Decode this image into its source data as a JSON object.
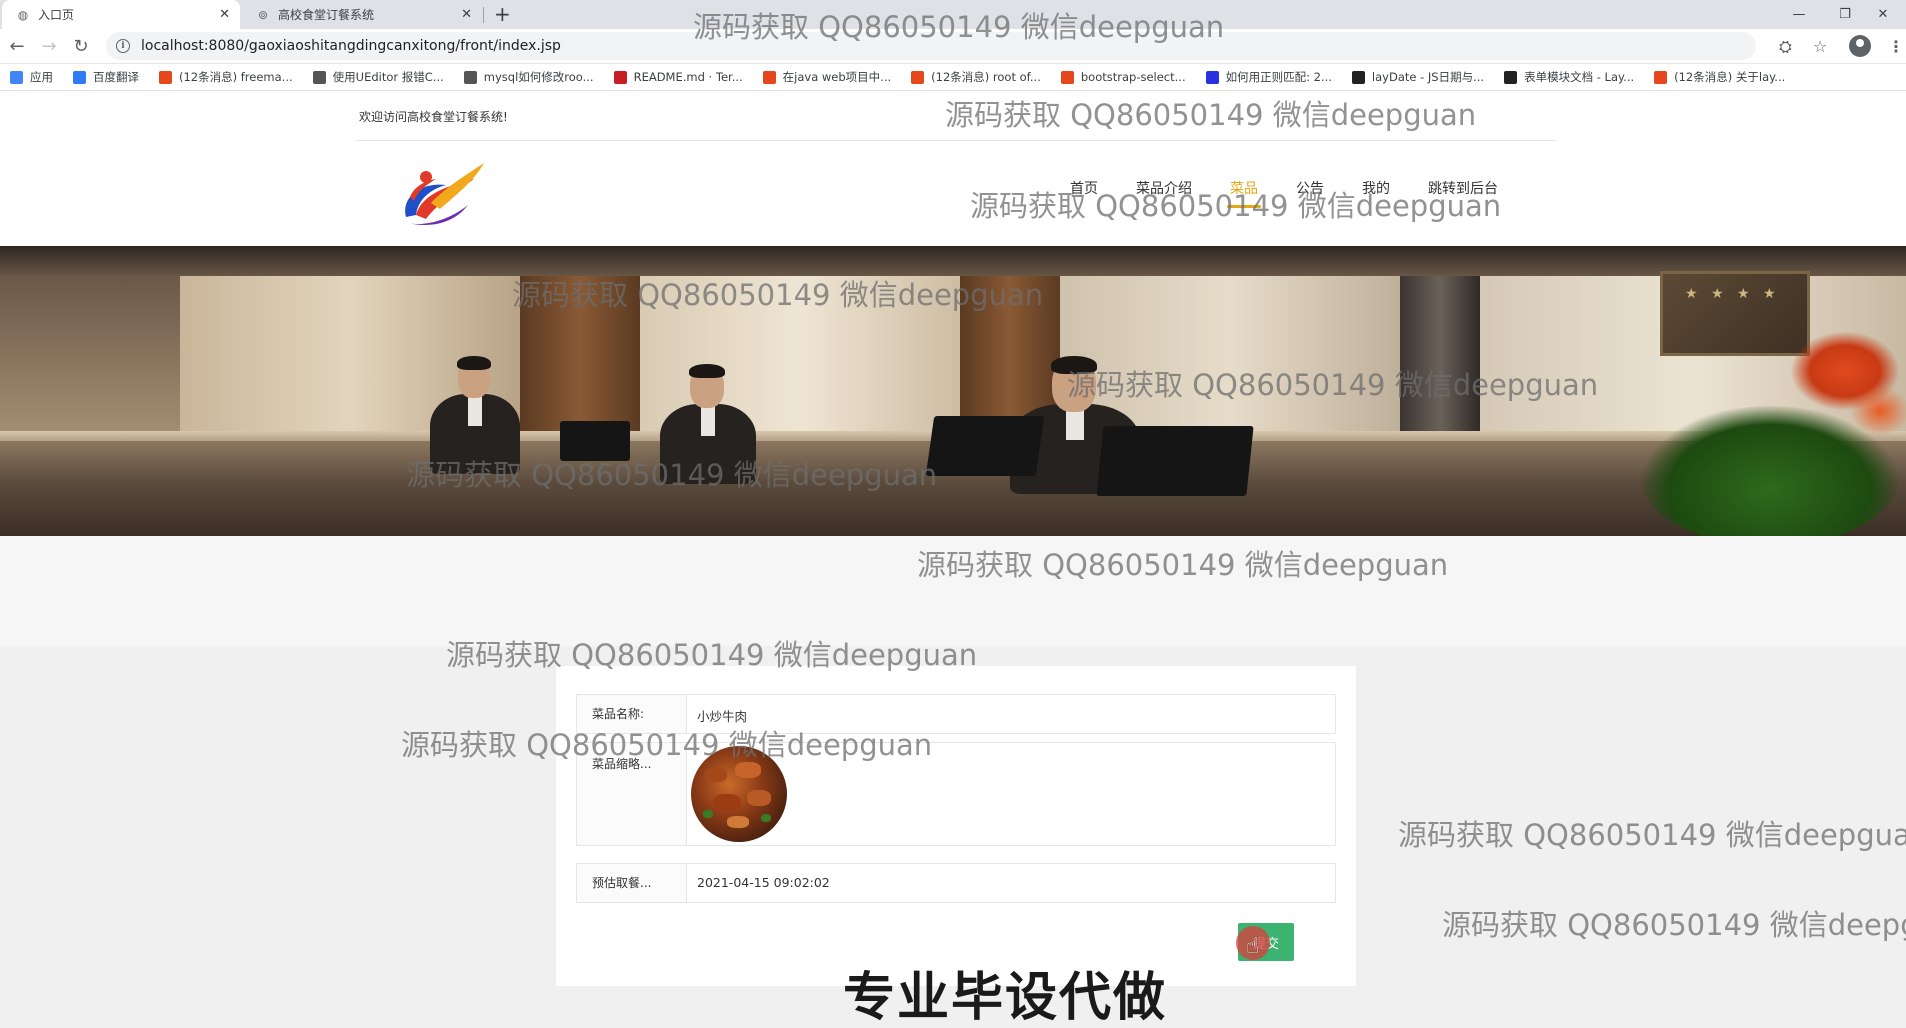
{
  "browser": {
    "tabs": [
      {
        "title": "入口页",
        "close": "✕",
        "icon": "globe-icon"
      },
      {
        "title": "高校食堂订餐系统",
        "close": "✕",
        "icon": "site-icon"
      }
    ],
    "new_tab": "+",
    "window_controls": [
      "—",
      "❐",
      "✕"
    ],
    "url": "localhost:8080/gaoxiaoshitangdingcanxitong/front/index.jsp",
    "bookmarks": [
      {
        "label": "应用",
        "icon": "apps-icon",
        "color": "#4285f4"
      },
      {
        "label": "百度翻译",
        "icon": "baidu-translate-icon",
        "color": "#2f7cf6"
      },
      {
        "label": "(12条消息) freema...",
        "icon": "csdn-icon",
        "color": "#e5481d"
      },
      {
        "label": "使用UEditor 报错C...",
        "icon": "bookmark-icon",
        "color": "#555555"
      },
      {
        "label": "mysql如何修改roo...",
        "icon": "bookmark-icon",
        "color": "#555555"
      },
      {
        "label": "README.md · Ter...",
        "icon": "gitee-icon",
        "color": "#c71d23"
      },
      {
        "label": "在java web项目中...",
        "icon": "csdn-icon",
        "color": "#e5481d"
      },
      {
        "label": "(12条消息) root of...",
        "icon": "csdn-icon",
        "color": "#e5481d"
      },
      {
        "label": "bootstrap-select...",
        "icon": "bookmark-icon",
        "color": "#e5481d"
      },
      {
        "label": "如何用正则匹配: 2...",
        "icon": "baidu-icon",
        "color": "#2932e1"
      },
      {
        "label": "layDate - JS日期与...",
        "icon": "layui-icon",
        "color": "#222222"
      },
      {
        "label": "表单模块文档 - Lay...",
        "icon": "layui-icon",
        "color": "#222222"
      },
      {
        "label": "(12条消息) 关于lay...",
        "icon": "csdn-icon",
        "color": "#e5481d"
      }
    ]
  },
  "site": {
    "welcome": "欢迎访问高校食堂订餐系统!",
    "menu": [
      {
        "label": "首页",
        "active": false
      },
      {
        "label": "菜品介绍",
        "active": false
      },
      {
        "label": "菜品",
        "active": true
      },
      {
        "label": "公告",
        "active": false
      },
      {
        "label": "我的",
        "active": false
      },
      {
        "label": "跳转到后台",
        "active": false
      }
    ],
    "accent_color": "#e6a817"
  },
  "form": {
    "dish_name_label": "菜品名称:",
    "dish_name_value": "小炒牛肉",
    "thumbnail_label": "菜品缩略...",
    "pickup_label": "预估取餐...",
    "pickup_value": "2021-04-15 09:02:02",
    "submit_label": "提交",
    "submit_color": "#3cb371"
  },
  "watermark": {
    "text": "源码获取 QQ86050149 微信deepguan",
    "bottom_text": "专业毕设代做"
  }
}
